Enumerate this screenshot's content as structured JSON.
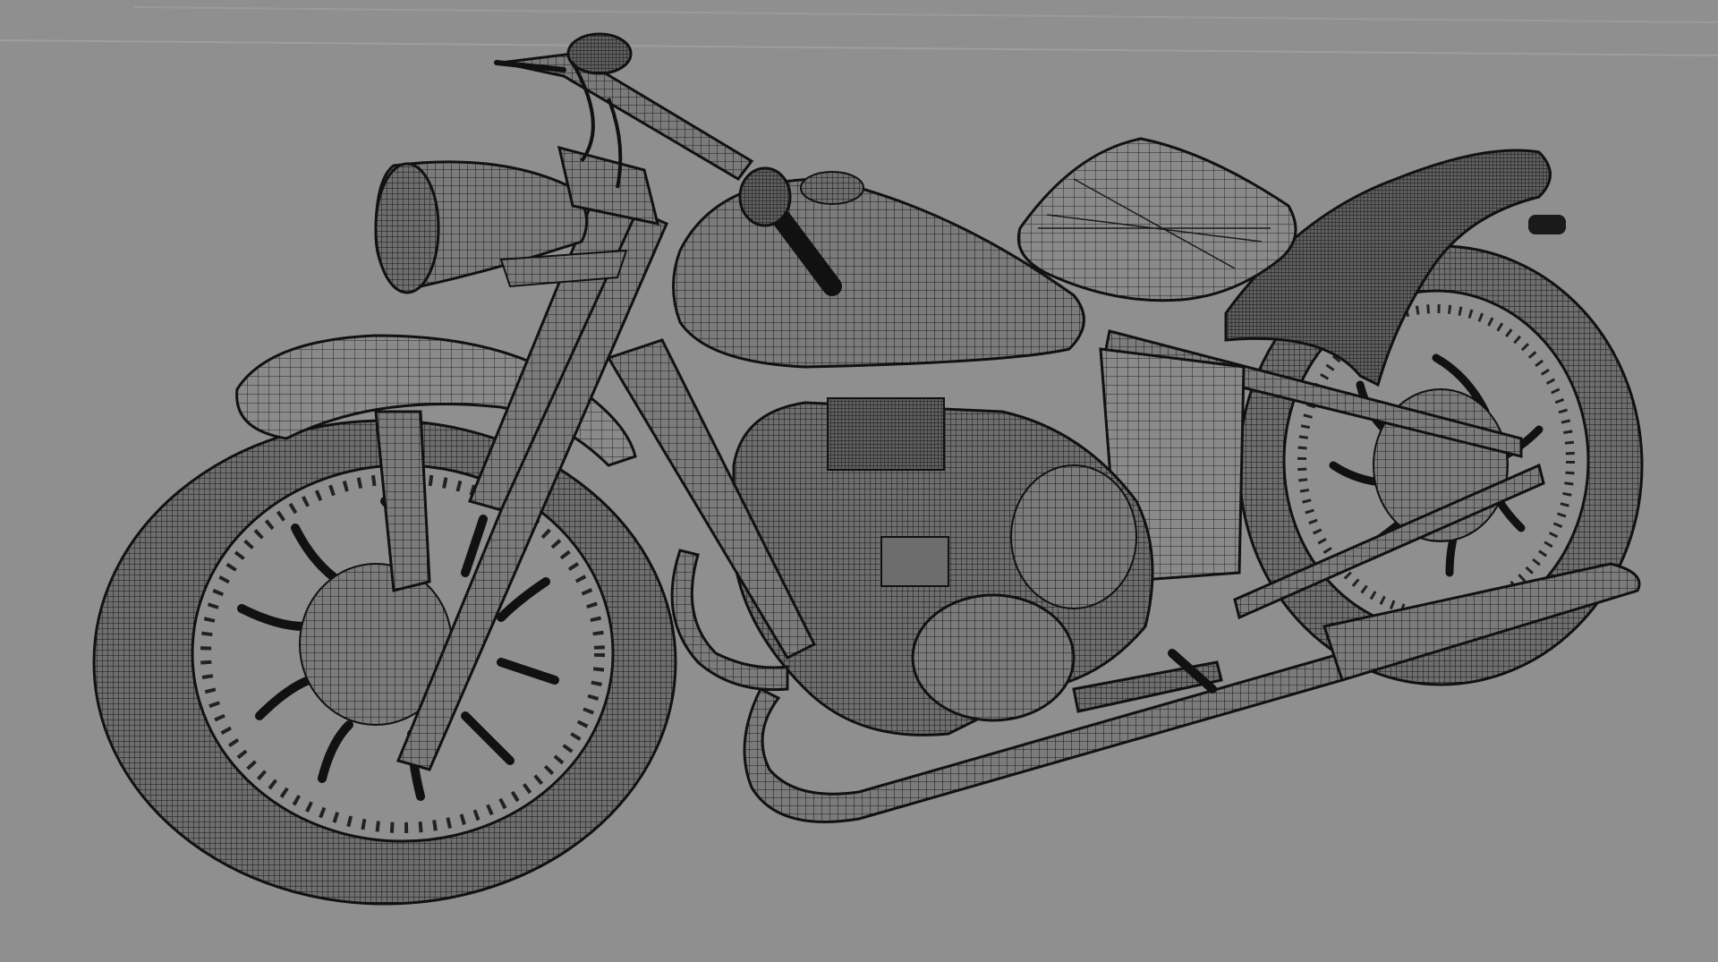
{
  "viewport": {
    "background_color": "#8f8f8f",
    "display_mode": "wireframe-on-shaded",
    "shaded_color": "#7a7a7a",
    "wire_color": "#1a1a1a"
  },
  "scene": {
    "object": "motorcycle-model",
    "parts": [
      "headlight",
      "handlebar",
      "fuel-tank",
      "seat",
      "rear-fender",
      "front-fender",
      "front-wheel",
      "rear-wheel",
      "front-fork",
      "engine",
      "exhaust-pipe",
      "frame",
      "footrest"
    ]
  }
}
